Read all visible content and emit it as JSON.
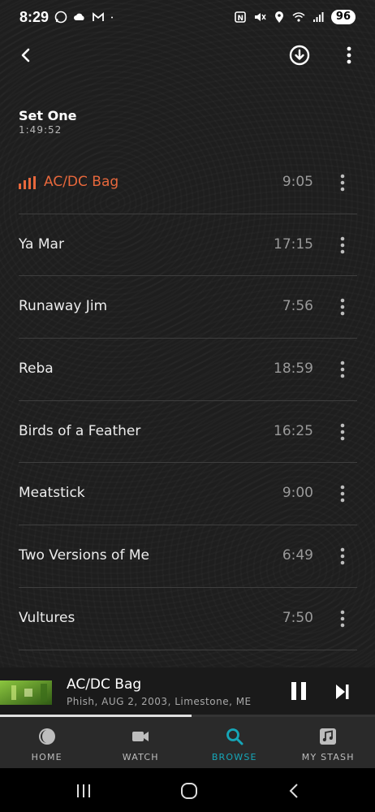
{
  "status_bar": {
    "time": "8:29",
    "battery": "96"
  },
  "set": {
    "title": "Set One",
    "duration": "1:49:52"
  },
  "tracks": [
    {
      "title": "AC/DC Bag",
      "duration": "9:05",
      "playing": true
    },
    {
      "title": "Ya Mar",
      "duration": "17:15"
    },
    {
      "title": "Runaway Jim",
      "duration": "7:56"
    },
    {
      "title": "Reba",
      "duration": "18:59"
    },
    {
      "title": "Birds of a Feather",
      "duration": "16:25"
    },
    {
      "title": "Meatstick",
      "duration": "9:00"
    },
    {
      "title": "Two Versions of Me",
      "duration": "6:49"
    },
    {
      "title": "Vultures",
      "duration": "7:50"
    }
  ],
  "mini_player": {
    "title": "AC/DC Bag",
    "subtitle": "Phish, AUG 2, 2003, Limestone, ME",
    "progress": 0.51
  },
  "bottom_nav": {
    "home": "HOME",
    "watch": "WATCH",
    "browse": "BROWSE",
    "stash": "MY STASH"
  },
  "colors": {
    "now_playing": "#e8683c",
    "active_tab": "#16a6b8"
  },
  "icons": [
    "back-arrow-icon",
    "download-icon",
    "more-vertical-icon",
    "equalizer-icon",
    "pause-icon",
    "skip-next-icon",
    "home-icon",
    "video-camera-icon",
    "search-icon",
    "music-note-icon"
  ]
}
